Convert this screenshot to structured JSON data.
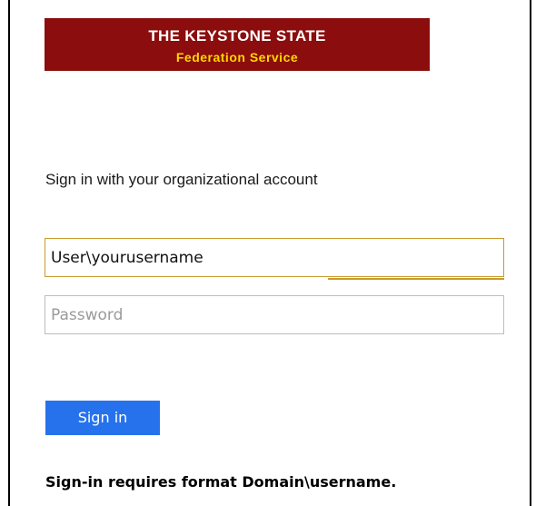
{
  "banner": {
    "title": "THE KEYSTONE STATE",
    "subtitle": "Federation Service",
    "bg_color": "#8b0d0d",
    "title_color": "#ffffff",
    "subtitle_color": "#ffd700"
  },
  "form": {
    "heading": "Sign in with your organizational account",
    "username_value": "User\\yourusername",
    "password_placeholder": "Password",
    "submit_label": "Sign in",
    "submit_color": "#2672ec",
    "hint": "Sign-in requires format Domain\\username."
  }
}
